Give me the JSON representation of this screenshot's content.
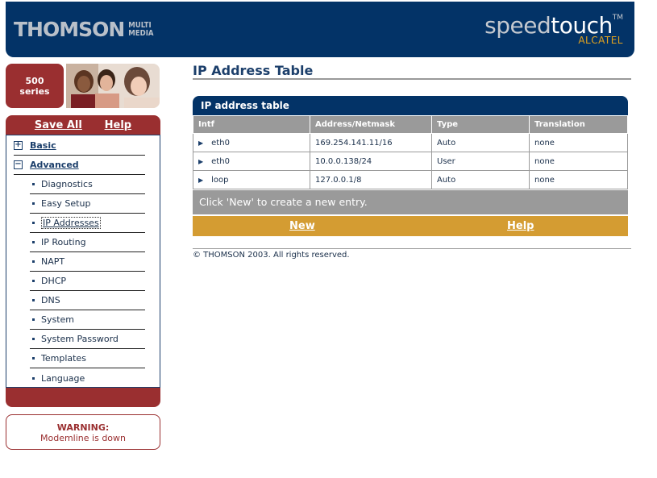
{
  "header": {
    "brand_left": "THOMSON",
    "brand_left_sub1": "MULTI",
    "brand_left_sub2": "MEDIA",
    "brand_speed": "speed",
    "brand_touch": "touch",
    "brand_tm": "TM",
    "brand_alcatel": "ALCATEL"
  },
  "sidebar": {
    "series_number": "500",
    "series_label": "series",
    "top_links": {
      "save_all": "Save All",
      "help": "Help"
    },
    "sections": [
      {
        "label": "Basic",
        "symbol": "+"
      },
      {
        "label": "Advanced",
        "symbol": "−"
      }
    ],
    "items": [
      {
        "label": "Diagnostics"
      },
      {
        "label": "Easy Setup"
      },
      {
        "label": "IP Addresses"
      },
      {
        "label": "IP Routing"
      },
      {
        "label": "NAPT"
      },
      {
        "label": "DHCP"
      },
      {
        "label": "DNS"
      },
      {
        "label": "System"
      },
      {
        "label": "System Password"
      },
      {
        "label": "Templates"
      },
      {
        "label": "Language"
      }
    ],
    "warning_title": "WARNING:",
    "warning_text": "Modemline is down"
  },
  "main": {
    "page_title": "IP Address Table",
    "panel_title": "IP address table",
    "columns": [
      "Intf",
      "Address/Netmask",
      "Type",
      "Translation"
    ],
    "rows": [
      {
        "intf": "eth0",
        "address": "169.254.141.11/16",
        "type": "Auto",
        "translation": "none"
      },
      {
        "intf": "eth0",
        "address": "10.0.0.138/24",
        "type": "User",
        "translation": "none"
      },
      {
        "intf": "loop",
        "address": "127.0.0.1/8",
        "type": "Auto",
        "translation": "none"
      }
    ],
    "note": "Click 'New' to create a new entry.",
    "new_label": "New",
    "help_label": "Help",
    "copyright": "© THOMSON 2003. All rights reserved."
  },
  "colors": {
    "navy": "#033367",
    "maroon": "#9a2f30",
    "gold": "#d49c32",
    "gray": "#9a9a9a"
  }
}
